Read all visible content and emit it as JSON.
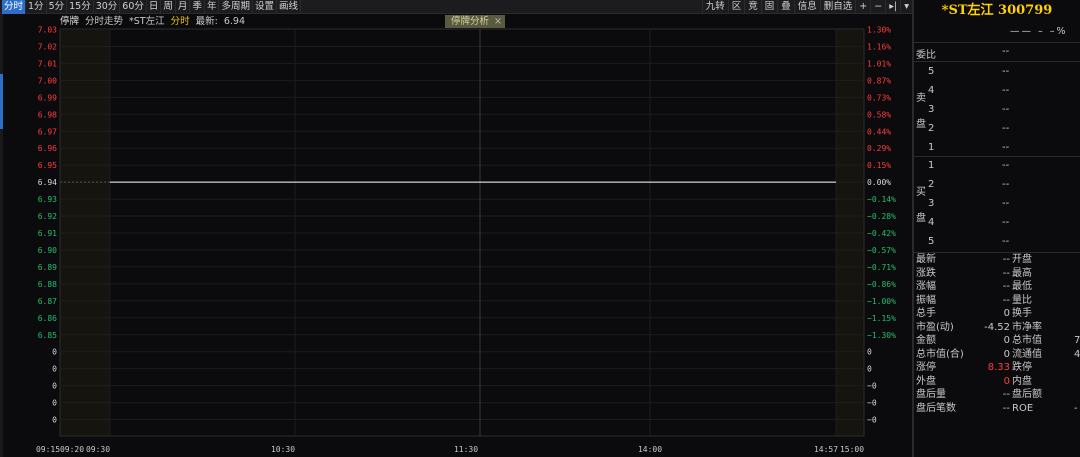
{
  "toolbar": {
    "left": [
      "分时",
      "1分",
      "5分",
      "15分",
      "30分",
      "60分",
      "日",
      "周",
      "月",
      "季",
      "年",
      "多周期",
      "设置",
      "画线"
    ],
    "active": "分时",
    "right": [
      "九转",
      "区",
      "竞",
      "固",
      "叠",
      "信息",
      "删自选",
      "+",
      "−",
      "▸|",
      "▾"
    ]
  },
  "info": {
    "halt": "停牌",
    "trend": "分时走势",
    "name": "*ST左江",
    "mode": "分时",
    "latest_label": "最新:",
    "latest_value": "6.94",
    "halt_tag": "停牌分析",
    "halt_close": "×"
  },
  "chart_data": {
    "type": "line",
    "price_ticks": [
      "7.03",
      "7.02",
      "7.01",
      "7.00",
      "6.99",
      "6.98",
      "6.97",
      "6.96",
      "6.95",
      "6.94",
      "6.93",
      "6.92",
      "6.91",
      "6.90",
      "6.89",
      "6.88",
      "6.87",
      "6.86",
      "6.85",
      "0",
      "0",
      "0",
      "0",
      "0"
    ],
    "pct_ticks": [
      "1.30%",
      "1.16%",
      "1.01%",
      "0.87%",
      "0.73%",
      "0.58%",
      "0.44%",
      "0.29%",
      "0.15%",
      "0.00%",
      "−0.14%",
      "−0.28%",
      "−0.42%",
      "−0.57%",
      "−0.71%",
      "−0.86%",
      "−1.00%",
      "−1.15%",
      "−1.30%",
      "0",
      "0",
      "−0",
      "−0",
      "−0"
    ],
    "x_ticks": [
      "09:15",
      "09:20",
      "09:30",
      "10:30",
      "11:30",
      "14:00",
      "14:57",
      "15:00"
    ],
    "pre_close": 6.94,
    "series": [
      {
        "values": [
          6.94,
          6.94
        ]
      }
    ],
    "colors": {
      "up": "#ff3b3b",
      "down": "#1fc06a",
      "flat": "#d8d8d8",
      "line": "#ffffff"
    }
  },
  "panel": {
    "title": "*ST左江 300799",
    "subline": "—— – –%",
    "weibi_label": "委比",
    "weibi_value": "--",
    "sell_label": [
      "卖",
      "盘"
    ],
    "buy_label": [
      "买",
      "盘"
    ],
    "sell": [
      {
        "lvl": "5",
        "px": "--"
      },
      {
        "lvl": "4",
        "px": "--"
      },
      {
        "lvl": "3",
        "px": "--"
      },
      {
        "lvl": "2",
        "px": "--"
      },
      {
        "lvl": "1",
        "px": "--"
      }
    ],
    "buy": [
      {
        "lvl": "1",
        "px": "--"
      },
      {
        "lvl": "2",
        "px": "--"
      },
      {
        "lvl": "3",
        "px": "--"
      },
      {
        "lvl": "4",
        "px": "--"
      },
      {
        "lvl": "5",
        "px": "--"
      }
    ],
    "stats": [
      {
        "l": "最新",
        "v": "--",
        "r": "开盘",
        "rv": ""
      },
      {
        "l": "涨跌",
        "v": "--",
        "r": "最高",
        "rv": ""
      },
      {
        "l": "涨幅",
        "v": "--",
        "r": "最低",
        "rv": ""
      },
      {
        "l": "振幅",
        "v": "--",
        "r": "量比",
        "rv": ""
      },
      {
        "l": "总手",
        "v": "0",
        "r": "换手",
        "rv": ""
      },
      {
        "l": "市盈(动)",
        "v": "-4.52",
        "r": "市净率",
        "rv": ""
      },
      {
        "l": "金额",
        "v": "0",
        "r": "总市值",
        "rv": "7"
      },
      {
        "l": "总市值(合)",
        "v": "0",
        "r": "流通值",
        "rv": "4"
      },
      {
        "l": "涨停",
        "v": "8.33",
        "r": "跌停",
        "rv": "",
        "vred": true
      },
      {
        "l": "外盘",
        "v": "0",
        "r": "内盘",
        "rv": "",
        "vred": true
      },
      {
        "l": "盘后量",
        "v": "--",
        "r": "盘后额",
        "rv": ""
      },
      {
        "l": "盘后笔数",
        "v": "--",
        "r": "ROE",
        "rv": "-"
      }
    ]
  }
}
